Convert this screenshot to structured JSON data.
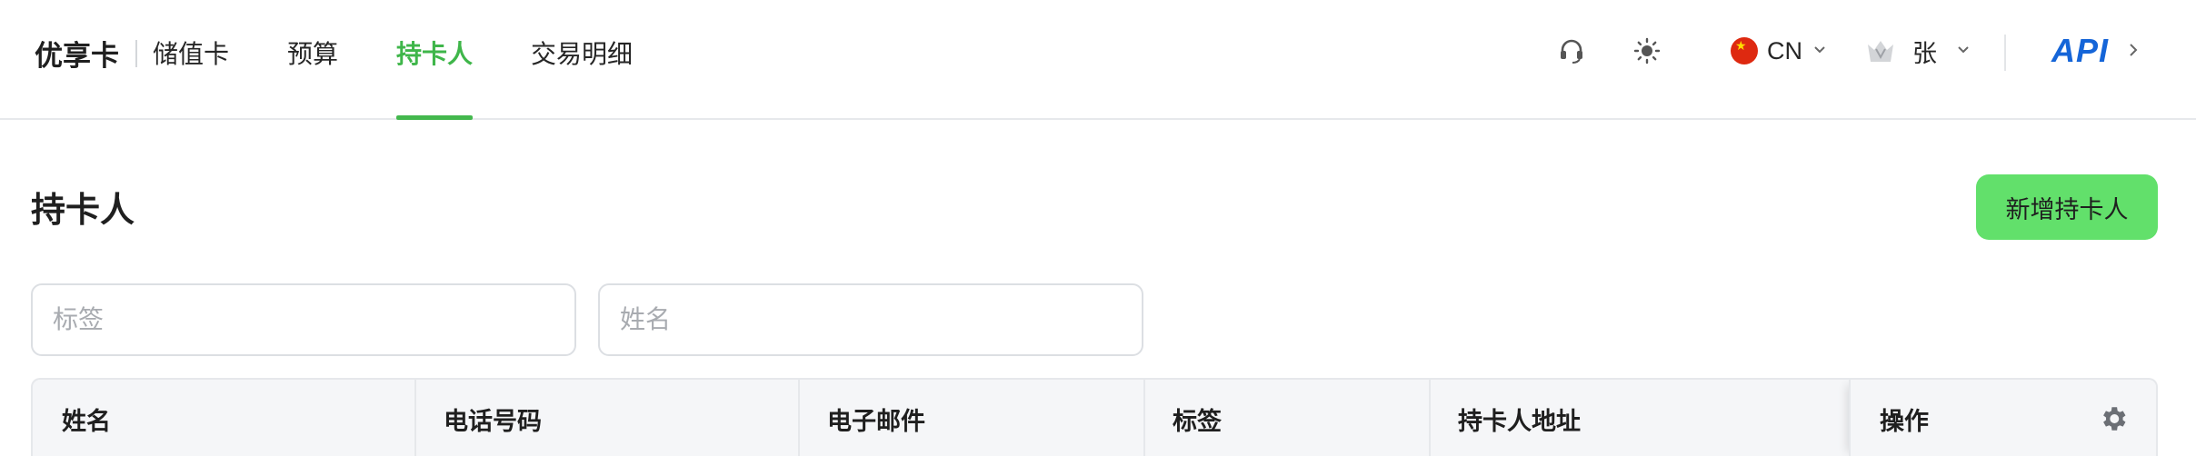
{
  "header": {
    "brand": "优享卡",
    "nav": [
      {
        "label": "储值卡",
        "active": false
      },
      {
        "label": "预算",
        "active": false
      },
      {
        "label": "持卡人",
        "active": true
      },
      {
        "label": "交易明细",
        "active": false
      }
    ],
    "icons": [
      "headset-icon",
      "sun-icon"
    ],
    "language": {
      "code": "CN",
      "flag": "china-flag-icon"
    },
    "user": {
      "name": "张",
      "avatar": "crown-avatar-icon"
    },
    "api_label": "API"
  },
  "page": {
    "title": "持卡人",
    "add_button_label": "新增持卡人"
  },
  "filters": {
    "tag_placeholder": "标签",
    "name_placeholder": "姓名"
  },
  "table": {
    "columns": [
      "姓名",
      "电话号码",
      "电子邮件",
      "标签",
      "持卡人地址"
    ],
    "ops_column": "操作"
  },
  "colors": {
    "accent": "#3fb64a",
    "button": "#62e06b",
    "api": "#1565d8"
  }
}
